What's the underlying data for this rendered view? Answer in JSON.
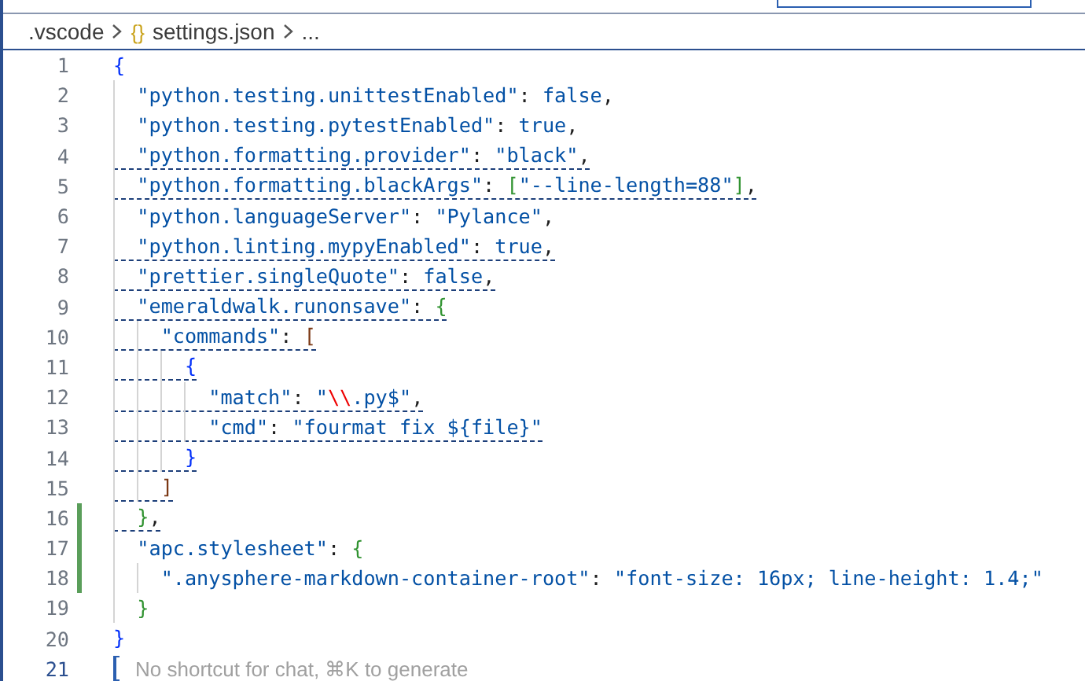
{
  "breadcrumb": [
    {
      "label": ".vscode"
    },
    {
      "glyph": "{}",
      "label": "settings.json"
    },
    {
      "label": "..."
    }
  ],
  "lines": [
    {
      "number": "1",
      "warning": false,
      "modified": false,
      "tokens": [
        {
          "text": "{",
          "color": "#0431fa"
        }
      ]
    },
    {
      "number": "2",
      "warning": false,
      "modified": false,
      "tokens": [
        {
          "text": "  \"python.testing.unittestEnabled\"",
          "color": "#0451a5"
        },
        {
          "text": ": ",
          "color": "#1f1f1f"
        },
        {
          "text": "false",
          "color": "#0451a5"
        },
        {
          "text": ",",
          "color": "#1f1f1f"
        }
      ]
    },
    {
      "number": "3",
      "warning": false,
      "modified": false,
      "tokens": [
        {
          "text": "  \"python.testing.pytestEnabled\"",
          "color": "#0451a5"
        },
        {
          "text": ": ",
          "color": "#1f1f1f"
        },
        {
          "text": "true",
          "color": "#0451a5"
        },
        {
          "text": ",",
          "color": "#1f1f1f"
        }
      ]
    },
    {
      "number": "4",
      "warning": true,
      "modified": false,
      "tokens": [
        {
          "text": "  \"python.formatting.provider\"",
          "color": "#0451a5"
        },
        {
          "text": ": ",
          "color": "#1f1f1f"
        },
        {
          "text": "\"black\"",
          "color": "#0451a5"
        },
        {
          "text": ",",
          "color": "#1f1f1f"
        }
      ]
    },
    {
      "number": "5",
      "warning": true,
      "modified": false,
      "tokens": [
        {
          "text": "  \"python.formatting.blackArgs\"",
          "color": "#0451a5"
        },
        {
          "text": ": ",
          "color": "#1f1f1f"
        },
        {
          "text": "[",
          "color": "#319331"
        },
        {
          "text": "\"--line-length=88\"",
          "color": "#0451a5"
        },
        {
          "text": "]",
          "color": "#319331"
        },
        {
          "text": ",",
          "color": "#1f1f1f"
        }
      ]
    },
    {
      "number": "6",
      "warning": false,
      "modified": false,
      "tokens": [
        {
          "text": "  \"python.languageServer\"",
          "color": "#0451a5"
        },
        {
          "text": ": ",
          "color": "#1f1f1f"
        },
        {
          "text": "\"Pylance\"",
          "color": "#0451a5"
        },
        {
          "text": ",",
          "color": "#1f1f1f"
        }
      ]
    },
    {
      "number": "7",
      "warning": true,
      "modified": false,
      "tokens": [
        {
          "text": "  \"python.linting.mypyEnabled\"",
          "color": "#0451a5"
        },
        {
          "text": ": ",
          "color": "#1f1f1f"
        },
        {
          "text": "true",
          "color": "#0451a5"
        },
        {
          "text": ",",
          "color": "#1f1f1f"
        }
      ]
    },
    {
      "number": "8",
      "warning": true,
      "modified": false,
      "tokens": [
        {
          "text": "  \"prettier.singleQuote\"",
          "color": "#0451a5"
        },
        {
          "text": ": ",
          "color": "#1f1f1f"
        },
        {
          "text": "false",
          "color": "#0451a5"
        },
        {
          "text": ",",
          "color": "#1f1f1f"
        }
      ]
    },
    {
      "number": "9",
      "warning": true,
      "modified": false,
      "tokens": [
        {
          "text": "  \"emeraldwalk.runonsave\"",
          "color": "#0451a5"
        },
        {
          "text": ": ",
          "color": "#1f1f1f"
        },
        {
          "text": "{",
          "color": "#319331"
        }
      ]
    },
    {
      "number": "10",
      "warning": true,
      "modified": false,
      "tokens": [
        {
          "text": "    \"commands\"",
          "color": "#0451a5"
        },
        {
          "text": ": ",
          "color": "#1f1f1f"
        },
        {
          "text": "[",
          "color": "#7b3814"
        }
      ]
    },
    {
      "number": "11",
      "warning": true,
      "modified": false,
      "tokens": [
        {
          "text": "      {",
          "color": "#0431fa"
        }
      ]
    },
    {
      "number": "12",
      "warning": true,
      "modified": false,
      "tokens": [
        {
          "text": "        \"match\"",
          "color": "#0451a5"
        },
        {
          "text": ": ",
          "color": "#1f1f1f"
        },
        {
          "text": "\"",
          "color": "#0451a5"
        },
        {
          "text": "\\\\",
          "color": "#ee0000"
        },
        {
          "text": ".py$\"",
          "color": "#0451a5"
        },
        {
          "text": ",",
          "color": "#1f1f1f"
        }
      ]
    },
    {
      "number": "13",
      "warning": true,
      "modified": false,
      "tokens": [
        {
          "text": "        \"cmd\"",
          "color": "#0451a5"
        },
        {
          "text": ": ",
          "color": "#1f1f1f"
        },
        {
          "text": "\"fourmat fix ${file}\"",
          "color": "#0451a5"
        }
      ]
    },
    {
      "number": "14",
      "warning": true,
      "modified": false,
      "tokens": [
        {
          "text": "      }",
          "color": "#0431fa"
        }
      ]
    },
    {
      "number": "15",
      "warning": true,
      "modified": false,
      "tokens": [
        {
          "text": "    ]",
          "color": "#7b3814"
        }
      ]
    },
    {
      "number": "16",
      "warning": true,
      "modified": true,
      "tokens": [
        {
          "text": "  }",
          "color": "#319331"
        },
        {
          "text": ",",
          "color": "#1f1f1f"
        }
      ]
    },
    {
      "number": "17",
      "warning": false,
      "modified": true,
      "tokens": [
        {
          "text": "  \"apc.stylesheet\"",
          "color": "#0451a5"
        },
        {
          "text": ": ",
          "color": "#1f1f1f"
        },
        {
          "text": "{",
          "color": "#319331"
        }
      ]
    },
    {
      "number": "18",
      "warning": false,
      "modified": true,
      "tokens": [
        {
          "text": "    \".anysphere-markdown-container-root\"",
          "color": "#0451a5"
        },
        {
          "text": ": ",
          "color": "#1f1f1f"
        },
        {
          "text": "\"font-size: 16px; line-height: 1.4;\"",
          "color": "#0451a5"
        }
      ]
    },
    {
      "number": "19",
      "warning": false,
      "modified": false,
      "tokens": [
        {
          "text": "  }",
          "color": "#319331"
        }
      ]
    },
    {
      "number": "20",
      "warning": false,
      "modified": false,
      "tokens": [
        {
          "text": "}",
          "color": "#0431fa"
        }
      ]
    },
    {
      "number": "21",
      "modified": false,
      "placeholder": "No shortcut for chat, ⌘K to generate"
    }
  ]
}
